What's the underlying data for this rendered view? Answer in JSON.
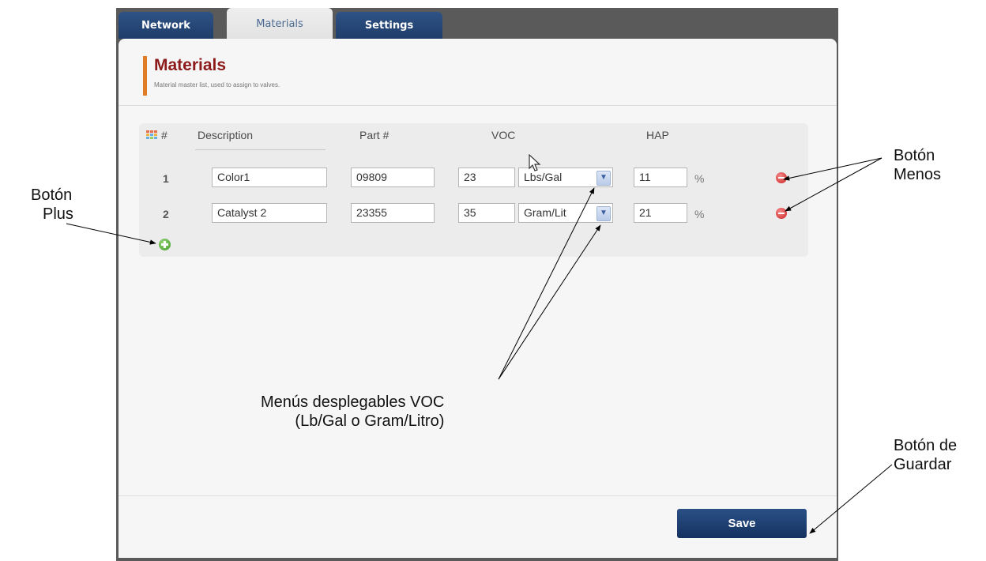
{
  "tabs": [
    {
      "label": "Network",
      "active": false
    },
    {
      "label": "Materials",
      "active": true
    },
    {
      "label": "Settings",
      "active": false
    }
  ],
  "header": {
    "title": "Materials",
    "subtitle": "Material master list, used to assign to valves."
  },
  "table": {
    "columns": [
      "#",
      "Description",
      "Part #",
      "VOC",
      "HAP"
    ],
    "rows": [
      {
        "num": "1",
        "description": "Color1",
        "part": "09809",
        "voc": "23",
        "voc_unit": "Lbs/Gal",
        "hap": "11",
        "hap_unit": "%"
      },
      {
        "num": "2",
        "description": "Catalyst 2",
        "part": "23355",
        "voc": "35",
        "voc_unit": "Gram/Lit",
        "hap": "21",
        "hap_unit": "%"
      }
    ]
  },
  "footer": {
    "save_label": "Save"
  },
  "callouts": {
    "plus": {
      "line1": "Botón",
      "line2": "Plus"
    },
    "minus": {
      "line1": "Botón",
      "line2": "Menos"
    },
    "voc": {
      "line1": "Menús desplegables VOC",
      "line2": "(Lb/Gal o Gram/Litro)"
    },
    "save": {
      "line1": "Botón de",
      "line2": "Guardar"
    }
  },
  "colors": {
    "tab_blue": "#2f5386",
    "title_red": "#8c1a1a",
    "accent_orange": "#e07b26",
    "save_blue": "#1e3d6a"
  },
  "icons": [
    "grid-icon",
    "minus-circle-icon",
    "plus-circle-icon",
    "chevron-down-icon",
    "mouse-cursor-icon"
  ]
}
